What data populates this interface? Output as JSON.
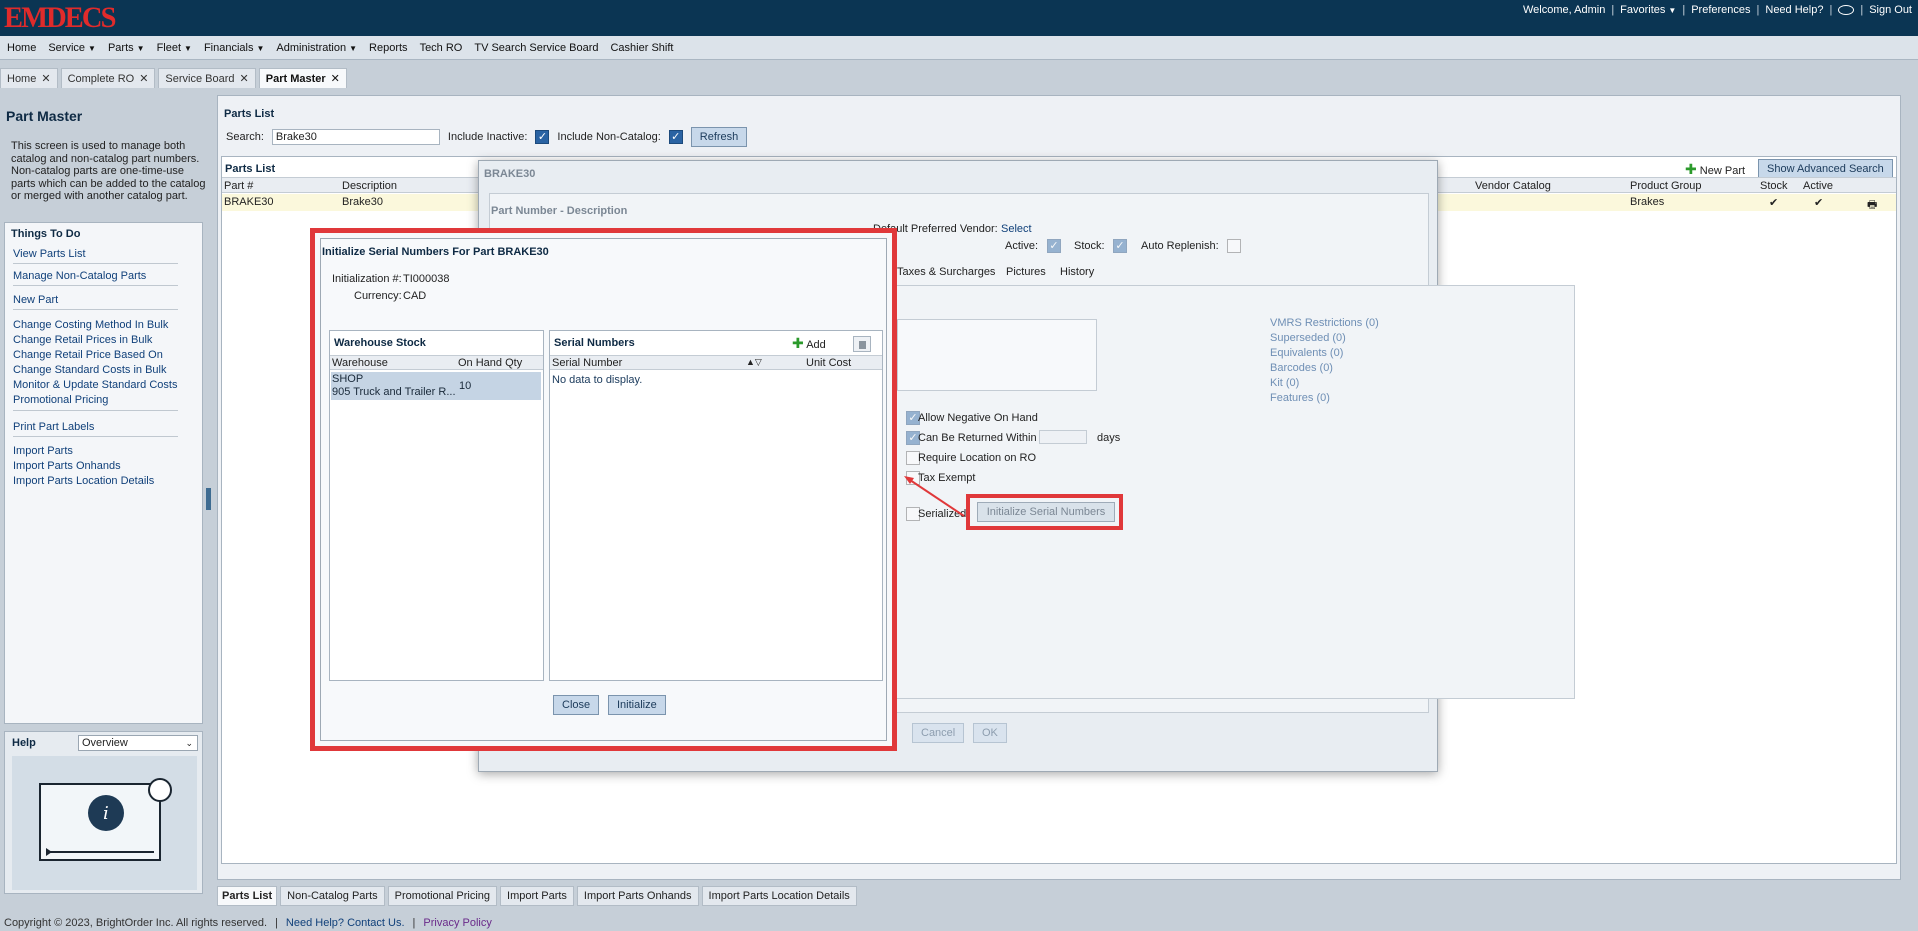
{
  "app": {
    "logo": "EMDECS"
  },
  "topnav": {
    "welcome": "Welcome, Admin",
    "favorites": "Favorites",
    "preferences": "Preferences",
    "need_help": "Need Help?",
    "sign_out": "Sign Out",
    "sep": "|"
  },
  "menu": [
    "Home",
    "Service",
    "Parts",
    "Fleet",
    "Financials",
    "Administration",
    "Reports",
    "Tech RO",
    "TV Search Service Board",
    "Cashier Shift"
  ],
  "tabs": [
    "Home",
    "Complete RO",
    "Service Board",
    "Part Master"
  ],
  "left": {
    "title": "Part Master",
    "description": "This screen is used to manage both catalog and non-catalog part numbers. Non-catalog parts are one-time-use parts which can be added to the catalog or merged with another catalog part.",
    "todo_title": "Things To Do",
    "links": [
      "View Parts List",
      "Manage Non-Catalog Parts",
      "New Part",
      "Change Costing Method In Bulk",
      "Change Retail Prices in Bulk",
      "Change Retail Price Based On",
      "Change Standard Costs in Bulk",
      "Monitor & Update Standard Costs",
      "Promotional Pricing",
      "Print Part Labels",
      "Import Parts",
      "Import Parts Onhands",
      "Import Parts Location Details"
    ],
    "help_title": "Help",
    "help_option": "Overview"
  },
  "parts": {
    "title": "Parts List",
    "search_label": "Search:",
    "search_value": "Brake30",
    "include_inactive": "Include Inactive:",
    "include_noncatalog": "Include Non-Catalog:",
    "refresh": "Refresh",
    "list_title": "Parts List",
    "new_part": "New Part",
    "advanced": "Show Advanced Search",
    "columns": {
      "part": "Part #",
      "desc": "Description",
      "vendor_catalog": "Vendor Catalog",
      "product_group": "Product Group",
      "stock": "Stock",
      "active": "Active"
    },
    "row": {
      "part": "BRAKE30",
      "desc": "Brake30",
      "product_group": "Brakes",
      "stock": "✔",
      "active": "✔"
    }
  },
  "bottom_tabs": [
    "Parts List",
    "Non-Catalog Parts",
    "Promotional Pricing",
    "Import Parts",
    "Import Parts Onhands",
    "Import Parts Location Details"
  ],
  "footer": {
    "copyright": "Copyright © 2023, BrightOrder Inc. All rights reserved.",
    "contact": "Need Help? Contact Us.",
    "privacy": "Privacy Policy"
  },
  "part_dialog": {
    "title": "BRAKE30",
    "subtitle": "Part Number - Description",
    "preferred_vendor": "Default Preferred Vendor:",
    "select": "Select",
    "active": "Active:",
    "stock": "Stock:",
    "auto_replenish": "Auto Replenish:",
    "tabs": [
      "Taxes & Surcharges",
      "Pictures",
      "History"
    ],
    "links": [
      "VMRS Restrictions (0)",
      "Superseded (0)",
      "Equivalents (0)",
      "Barcodes (0)",
      "Kit (0)",
      "Features (0)"
    ],
    "options": [
      "Allow Negative On Hand",
      "Can Be Returned Within",
      "Require Location on RO",
      "Tax Exempt",
      "Serialized"
    ],
    "days": "days",
    "init_serial": "Initialize Serial Numbers",
    "cancel": "Cancel",
    "ok": "OK"
  },
  "serial_dialog": {
    "title": "Initialize Serial Numbers For Part BRAKE30",
    "init_label": "Initialization #:",
    "init_value": "TI000038",
    "currency_label": "Currency:",
    "currency_value": "CAD",
    "warehouse_title": "Warehouse Stock",
    "wh_col_warehouse": "Warehouse",
    "wh_col_qty": "On Hand Qty",
    "wh_row_code": "SHOP",
    "wh_row_name": "905 Truck and Trailer R...",
    "wh_row_qty": "10",
    "serial_title": "Serial Numbers",
    "add": "Add",
    "sn_col_serial": "Serial Number",
    "sn_col_cost": "Unit Cost",
    "no_data": "No data to display.",
    "close": "Close",
    "initialize": "Initialize"
  },
  "colors": {
    "accent_red": "#e0383a",
    "brand_navy": "#0b3553",
    "link_blue": "#10407a"
  }
}
